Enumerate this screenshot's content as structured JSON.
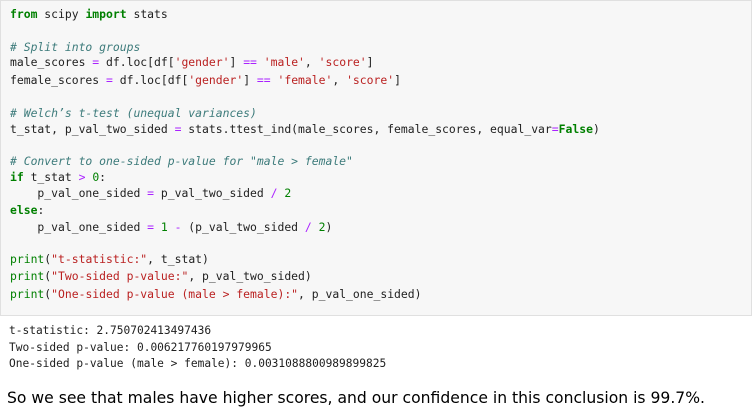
{
  "code_cell": {
    "lines": [
      [
        {
          "t": "kw",
          "v": "from"
        },
        {
          "t": "p",
          "v": " scipy "
        },
        {
          "t": "kw",
          "v": "import"
        },
        {
          "t": "p",
          "v": " stats"
        }
      ],
      [],
      [
        {
          "t": "cm",
          "v": "# Split into groups"
        }
      ],
      [
        {
          "t": "p",
          "v": "male_scores "
        },
        {
          "t": "op",
          "v": "="
        },
        {
          "t": "p",
          "v": " df.loc[df["
        },
        {
          "t": "str",
          "v": "'gender'"
        },
        {
          "t": "p",
          "v": "] "
        },
        {
          "t": "op",
          "v": "=="
        },
        {
          "t": "p",
          "v": " "
        },
        {
          "t": "str",
          "v": "'male'"
        },
        {
          "t": "p",
          "v": ", "
        },
        {
          "t": "str",
          "v": "'score'"
        },
        {
          "t": "p",
          "v": "]"
        }
      ],
      [
        {
          "t": "p",
          "v": "female_scores "
        },
        {
          "t": "op",
          "v": "="
        },
        {
          "t": "p",
          "v": " df.loc[df["
        },
        {
          "t": "str",
          "v": "'gender'"
        },
        {
          "t": "p",
          "v": "] "
        },
        {
          "t": "op",
          "v": "=="
        },
        {
          "t": "p",
          "v": " "
        },
        {
          "t": "str",
          "v": "'female'"
        },
        {
          "t": "p",
          "v": ", "
        },
        {
          "t": "str",
          "v": "'score'"
        },
        {
          "t": "p",
          "v": "]"
        }
      ],
      [],
      [
        {
          "t": "cm",
          "v": "# Welch’s t-test (unequal variances)"
        }
      ],
      [
        {
          "t": "p",
          "v": "t_stat, p_val_two_sided "
        },
        {
          "t": "op",
          "v": "="
        },
        {
          "t": "p",
          "v": " stats.ttest_ind(male_scores, female_scores, equal_var"
        },
        {
          "t": "op",
          "v": "="
        },
        {
          "t": "bool",
          "v": "False"
        },
        {
          "t": "p",
          "v": ")"
        }
      ],
      [],
      [
        {
          "t": "cm",
          "v": "# Convert to one-sided p-value for \"male > female\""
        }
      ],
      [
        {
          "t": "kw",
          "v": "if"
        },
        {
          "t": "p",
          "v": " t_stat "
        },
        {
          "t": "op",
          "v": ">"
        },
        {
          "t": "p",
          "v": " "
        },
        {
          "t": "num",
          "v": "0"
        },
        {
          "t": "p",
          "v": ":"
        }
      ],
      [
        {
          "t": "p",
          "v": "    p_val_one_sided "
        },
        {
          "t": "op",
          "v": "="
        },
        {
          "t": "p",
          "v": " p_val_two_sided "
        },
        {
          "t": "op",
          "v": "/"
        },
        {
          "t": "p",
          "v": " "
        },
        {
          "t": "num",
          "v": "2"
        }
      ],
      [
        {
          "t": "kw",
          "v": "else"
        },
        {
          "t": "p",
          "v": ":"
        }
      ],
      [
        {
          "t": "p",
          "v": "    p_val_one_sided "
        },
        {
          "t": "op",
          "v": "="
        },
        {
          "t": "p",
          "v": " "
        },
        {
          "t": "num",
          "v": "1"
        },
        {
          "t": "p",
          "v": " "
        },
        {
          "t": "op",
          "v": "-"
        },
        {
          "t": "p",
          "v": " (p_val_two_sided "
        },
        {
          "t": "op",
          "v": "/"
        },
        {
          "t": "p",
          "v": " "
        },
        {
          "t": "num",
          "v": "2"
        },
        {
          "t": "p",
          "v": ")"
        }
      ],
      [],
      [
        {
          "t": "kw2",
          "v": "print"
        },
        {
          "t": "p",
          "v": "("
        },
        {
          "t": "str",
          "v": "\"t-statistic:\""
        },
        {
          "t": "p",
          "v": ", t_stat)"
        }
      ],
      [
        {
          "t": "kw2",
          "v": "print"
        },
        {
          "t": "p",
          "v": "("
        },
        {
          "t": "str",
          "v": "\"Two-sided p-value:\""
        },
        {
          "t": "p",
          "v": ", p_val_two_sided)"
        }
      ],
      [
        {
          "t": "kw2",
          "v": "print"
        },
        {
          "t": "p",
          "v": "("
        },
        {
          "t": "str",
          "v": "\"One-sided p-value (male > female):\""
        },
        {
          "t": "p",
          "v": ", p_val_one_sided)"
        }
      ]
    ]
  },
  "output": {
    "lines": [
      "t-statistic: 2.750702413497436",
      "Two-sided p-value: 0.006217760197979965",
      "One-sided p-value (male > female): 0.0031088800989899825"
    ]
  },
  "conclusion": "So we see that males have higher scores, and our confidence in this conclusion is 99.7%.",
  "colors": {
    "keyword": "#008000",
    "comment": "#3d7b7b",
    "string": "#ba2121",
    "operator": "#aa22ff",
    "cell_background": "#f7f7f7"
  }
}
